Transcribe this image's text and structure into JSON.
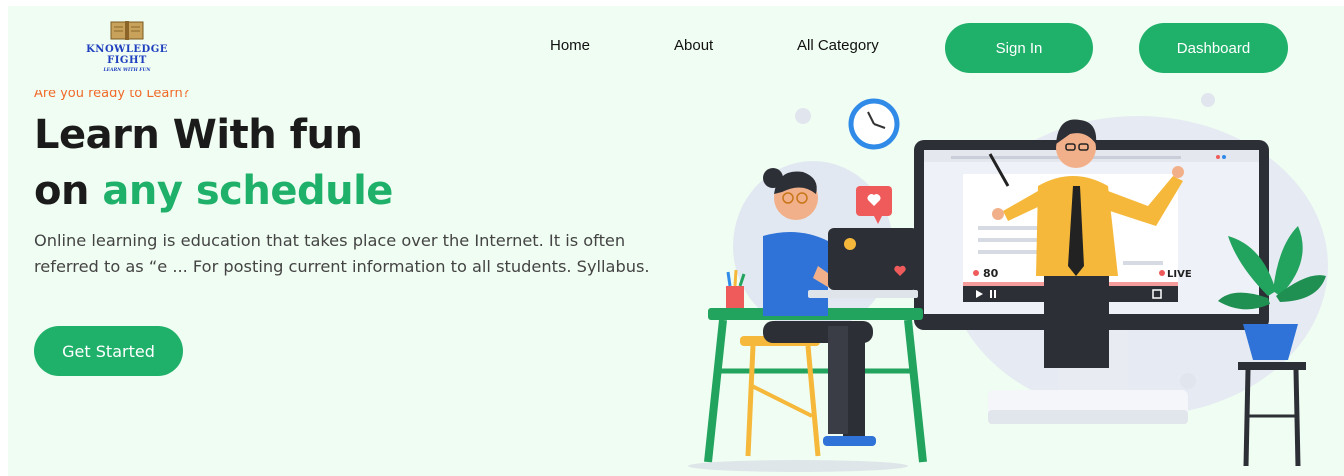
{
  "navbar": {
    "logo": {
      "line1": "KNOWLEDGE",
      "line2": "FIGHT",
      "tagline": "LEARN WITH FUN"
    },
    "links": [
      "Home",
      "About",
      "All Category"
    ],
    "signin_label": "Sign In",
    "dashboard_label": "Dashboard"
  },
  "hero": {
    "eyebrow": "Are you ready to Learn?",
    "title_line1": "Learn With fun",
    "title_line2_prefix": "on ",
    "title_line2_accent": "any schedule",
    "description": "Online learning is education that takes place over the Internet. It is often referred to as “e ... For posting current information to all students. Syllabus.",
    "cta_label": "Get Started"
  },
  "illustration": {
    "viewer_count": "80",
    "live_label": "LIVE"
  },
  "colors": {
    "accent": "#1fb06a",
    "page_bg": "#f0fdf2",
    "eyebrow": "#f06a2a",
    "logo": "#1e3fbf"
  }
}
